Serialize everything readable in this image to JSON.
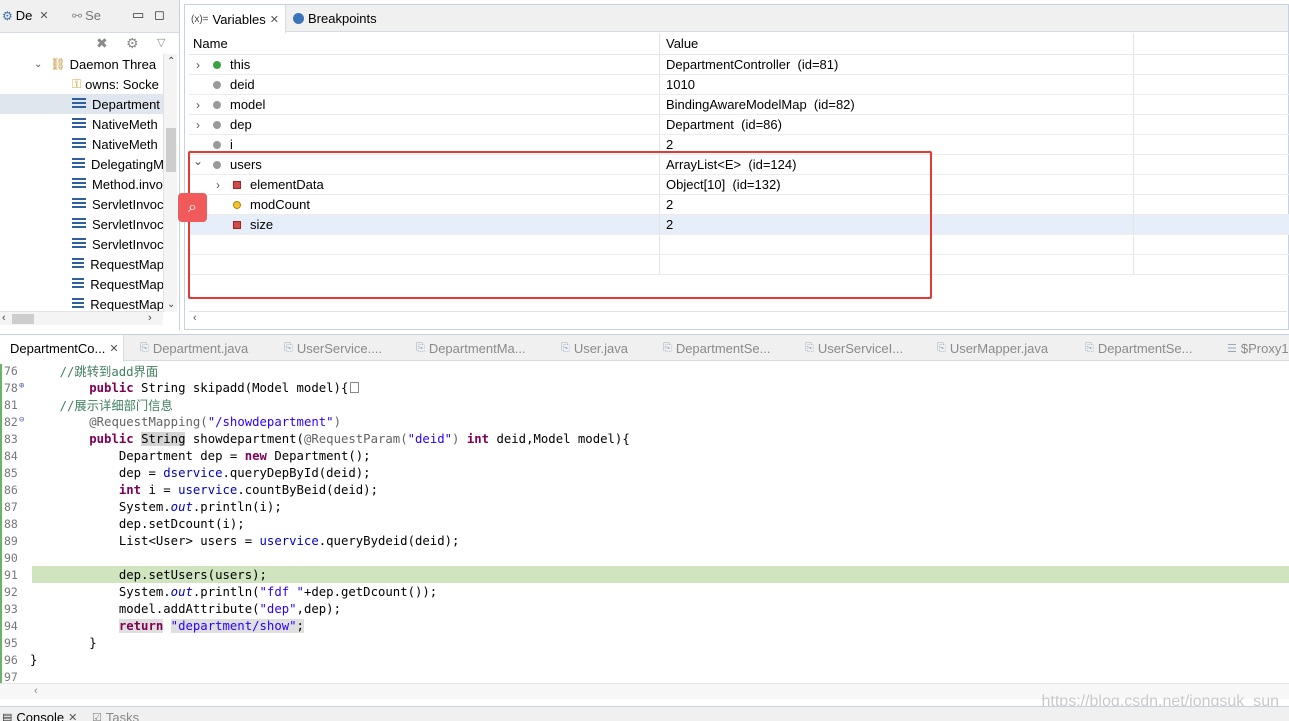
{
  "debug_view": {
    "tabs": [
      {
        "label": "De",
        "icon": "debug-icon"
      },
      {
        "label": "Se",
        "icon": "servers-icon"
      }
    ],
    "thread": "Daemon Threa",
    "stack_frames": [
      {
        "label": "owns: Socke",
        "icon": "key-icon"
      },
      {
        "label": "Department",
        "icon": "stack-frame-icon",
        "selected": true
      },
      {
        "label": "NativeMeth",
        "icon": "stack-frame-icon"
      },
      {
        "label": "NativeMeth",
        "icon": "stack-frame-icon"
      },
      {
        "label": "DelegatingM",
        "icon": "stack-frame-icon"
      },
      {
        "label": "Method.invo",
        "icon": "stack-frame-icon"
      },
      {
        "label": "ServletInvoc",
        "icon": "stack-frame-icon"
      },
      {
        "label": "ServletInvoc",
        "icon": "stack-frame-icon"
      },
      {
        "label": "ServletInvoc",
        "icon": "stack-frame-icon"
      },
      {
        "label": "RequestMap",
        "icon": "stack-frame-icon"
      },
      {
        "label": "RequestMap",
        "icon": "stack-frame-icon"
      },
      {
        "label": "RequestMap",
        "icon": "stack-frame-icon"
      }
    ]
  },
  "variables_view": {
    "tabs": {
      "variables_prefix": "(x)=",
      "variables": "Variables",
      "breakpoints": "Breakpoints"
    },
    "columns": {
      "name": "Name",
      "value": "Value"
    },
    "rows": [
      {
        "name": "this",
        "value": "DepartmentController  (id=81)",
        "expandable": true,
        "expanded": false,
        "icon": "green-dot",
        "depth": 0
      },
      {
        "name": "deid",
        "value": "1010",
        "expandable": false,
        "icon": "gray-dot",
        "depth": 0
      },
      {
        "name": "model",
        "value": "BindingAwareModelMap  (id=82)",
        "expandable": true,
        "expanded": false,
        "icon": "gray-dot",
        "depth": 0
      },
      {
        "name": "dep",
        "value": "Department  (id=86)",
        "expandable": true,
        "expanded": false,
        "icon": "gray-dot",
        "depth": 0
      },
      {
        "name": "i",
        "value": "2",
        "expandable": false,
        "icon": "gray-dot",
        "depth": 0
      },
      {
        "name": "users",
        "value": "ArrayList<E>  (id=124)",
        "expandable": true,
        "expanded": true,
        "icon": "gray-dot",
        "depth": 0
      },
      {
        "name": "elementData",
        "value": "Object[10]  (id=132)",
        "expandable": true,
        "expanded": false,
        "icon": "red-square",
        "depth": 1
      },
      {
        "name": "modCount",
        "value": "2",
        "expandable": false,
        "icon": "yellow-dot",
        "depth": 1
      },
      {
        "name": "size",
        "value": "2",
        "expandable": false,
        "icon": "red-square",
        "depth": 1,
        "selected": true
      },
      {
        "name": "",
        "value": "",
        "depth": 0
      },
      {
        "name": "",
        "value": "",
        "depth": 0
      }
    ]
  },
  "editor": {
    "tabs": [
      "DepartmentCo...",
      "Department.java",
      "UserService....",
      "DepartmentMa...",
      "User.java",
      "DepartmentSe...",
      "UserServiceI...",
      "UserMapper.java",
      "DepartmentSe...",
      "$Proxy1"
    ],
    "lines": [
      {
        "n": "76",
        "tokens": [
          {
            "t": "    "
          },
          {
            "t": "//跳转到add界面",
            "c": "cmt"
          }
        ]
      },
      {
        "n": "78",
        "fold": "+",
        "tokens": [
          {
            "t": "        "
          },
          {
            "t": "public",
            "c": "kw"
          },
          {
            "t": " String skipadd(Model model){"
          }
        ],
        "collapsed": true
      },
      {
        "n": "81",
        "tokens": [
          {
            "t": "    "
          },
          {
            "t": "//展示详细部门信息",
            "c": "cmt"
          }
        ]
      },
      {
        "n": "82",
        "fold": "-",
        "tokens": [
          {
            "t": "        "
          },
          {
            "t": "@RequestMapping(",
            "c": "ann"
          },
          {
            "t": "\"/showdepartment\"",
            "c": "str"
          },
          {
            "t": ")",
            "c": "ann"
          }
        ]
      },
      {
        "n": "83",
        "tokens": [
          {
            "t": "        "
          },
          {
            "t": "public",
            "c": "kw"
          },
          {
            "t": " "
          },
          {
            "t": "String",
            "c": "gray-bg"
          },
          {
            "t": " showdepartment("
          },
          {
            "t": "@RequestParam(",
            "c": "ann"
          },
          {
            "t": "\"deid\"",
            "c": "str"
          },
          {
            "t": ") ",
            "c": "ann"
          },
          {
            "t": "int",
            "c": "kw"
          },
          {
            "t": " deid,Model model){"
          }
        ]
      },
      {
        "n": "84",
        "tokens": [
          {
            "t": "            Department dep = "
          },
          {
            "t": "new",
            "c": "kw"
          },
          {
            "t": " Department();"
          }
        ]
      },
      {
        "n": "85",
        "tokens": [
          {
            "t": "            dep = "
          },
          {
            "t": "dservice",
            "c": "fld"
          },
          {
            "t": ".queryDepById(deid);"
          }
        ]
      },
      {
        "n": "86",
        "tokens": [
          {
            "t": "            "
          },
          {
            "t": "int",
            "c": "kw"
          },
          {
            "t": " i = "
          },
          {
            "t": "uservice",
            "c": "fld"
          },
          {
            "t": ".countByBeid(deid);"
          }
        ]
      },
      {
        "n": "87",
        "tokens": [
          {
            "t": "            System."
          },
          {
            "t": "out",
            "c": "stat"
          },
          {
            "t": ".println(i);"
          }
        ]
      },
      {
        "n": "88",
        "tokens": [
          {
            "t": "            dep.setDcount(i);"
          }
        ]
      },
      {
        "n": "89",
        "tokens": [
          {
            "t": "            List<User> users = "
          },
          {
            "t": "uservice",
            "c": "fld"
          },
          {
            "t": ".queryBydeid(deid);"
          }
        ]
      },
      {
        "n": "90",
        "tokens": [
          {
            "t": ""
          }
        ]
      },
      {
        "n": "91",
        "current": true,
        "tokens": [
          {
            "t": "            dep.setUsers(users);"
          }
        ]
      },
      {
        "n": "92",
        "tokens": [
          {
            "t": "            System."
          },
          {
            "t": "out",
            "c": "stat"
          },
          {
            "t": ".println("
          },
          {
            "t": "\"fdf \"",
            "c": "str"
          },
          {
            "t": "+dep.getDcount());"
          }
        ]
      },
      {
        "n": "93",
        "tokens": [
          {
            "t": "            model.addAttribute("
          },
          {
            "t": "\"dep\"",
            "c": "str"
          },
          {
            "t": ",dep);"
          }
        ]
      },
      {
        "n": "94",
        "tokens": [
          {
            "t": "            "
          },
          {
            "t": "return",
            "c": "kw ret-bg"
          },
          {
            "t": " "
          },
          {
            "t": "\"department/show\"",
            "c": "str ret-bg"
          },
          {
            "t": ";",
            "c": "ret-bg"
          }
        ]
      },
      {
        "n": "95",
        "tokens": [
          {
            "t": "        }"
          }
        ]
      },
      {
        "n": "96",
        "tokens": [
          {
            "t": "}"
          }
        ]
      },
      {
        "n": "97",
        "tokens": [
          {
            "t": ""
          }
        ]
      }
    ],
    "watermark": "https://blog.csdn.net/jongsuk_sun"
  },
  "bottom_tabs": [
    {
      "label": "Console",
      "icon": "console-icon"
    },
    {
      "label": "Tasks",
      "icon": "tasks-icon"
    }
  ]
}
